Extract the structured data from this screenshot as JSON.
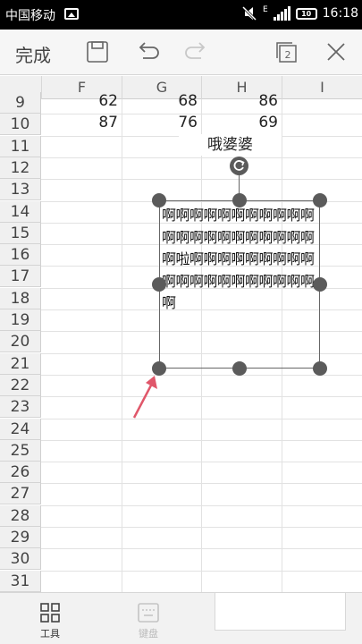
{
  "status_bar": {
    "carrier": "中国移动",
    "network_type": "E",
    "battery_level": "10",
    "time": "16:18"
  },
  "toolbar": {
    "done_label": "完成"
  },
  "sheet": {
    "columns": [
      "F",
      "G",
      "H",
      "I"
    ],
    "rows": [
      "9",
      "10",
      "11",
      "12",
      "13",
      "14",
      "15",
      "16",
      "17",
      "18",
      "19",
      "20",
      "21",
      "22",
      "23",
      "24",
      "25",
      "26",
      "27",
      "28",
      "29",
      "30",
      "31"
    ],
    "row9_values": [
      "62",
      "68",
      "86"
    ],
    "row10_values": [
      "87",
      "76",
      "69"
    ],
    "row11_text": "哦婆婆",
    "textbox_text": "啊啊啊啊啊啊啊啊啊啊啊啊啊啊啊啊啊啊啊啊啊啊啊啦啊啊啊啊啊啊啊啊啊啊啊啊啊啊啊啊啊啊啊啊啊"
  },
  "bottom_bar": {
    "tools_label": "工具",
    "keyboard_label": "键盘"
  }
}
